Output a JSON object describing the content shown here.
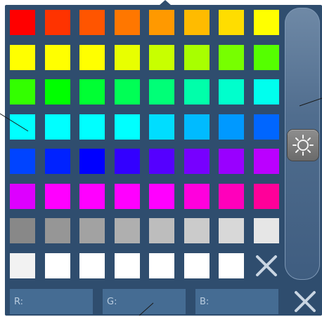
{
  "palette": {
    "rows": [
      [
        "#ff0000",
        "#ff3300",
        "#ff5500",
        "#ff7700",
        "#ff9900",
        "#ffbb00",
        "#ffdd00",
        "#ffff00"
      ],
      [
        "#ffff00",
        "#ffff00",
        "#ffff00",
        "#e8ff00",
        "#c8ff00",
        "#a8ff00",
        "#77ff00",
        "#55ff00"
      ],
      [
        "#33ff00",
        "#00ff00",
        "#00ff33",
        "#00ff55",
        "#00ff77",
        "#00ffaa",
        "#00ffcc",
        "#00ffee"
      ],
      [
        "#00ffff",
        "#00ffff",
        "#00ffff",
        "#00ffff",
        "#00ddff",
        "#00bbff",
        "#0099ff",
        "#0066ff"
      ],
      [
        "#0044ff",
        "#0022ff",
        "#0000ff",
        "#3300ff",
        "#5500ff",
        "#7700ff",
        "#9900ff",
        "#bb00ff"
      ],
      [
        "#dd00ff",
        "#ff00ff",
        "#ff00ff",
        "#ff00ff",
        "#ff00ff",
        "#ff00dd",
        "#ff00bb",
        "#ff0099"
      ],
      [
        "#888888",
        "#969696",
        "#a2a2a2",
        "#afafaf",
        "#bdbdbd",
        "#cbcbcb",
        "#d8d8d8",
        "#e6e6e6"
      ],
      [
        "#f2f2f2",
        "#ffffff",
        "#ffffff",
        "#ffffff",
        "#ffffff",
        "#ffffff",
        "#ffffff"
      ]
    ]
  },
  "icons": {
    "clear": "close-icon",
    "close": "close-icon",
    "brightness": "sun-icon"
  },
  "fields": {
    "r": {
      "label": "R:",
      "value": ""
    },
    "g": {
      "label": "G:",
      "value": ""
    },
    "b": {
      "label": "B:",
      "value": ""
    }
  },
  "colors": {
    "panel": "#2f4d6e",
    "field": "#456c93",
    "field_text": "#b9ccdf",
    "x_icon": "#c9d5e2"
  }
}
